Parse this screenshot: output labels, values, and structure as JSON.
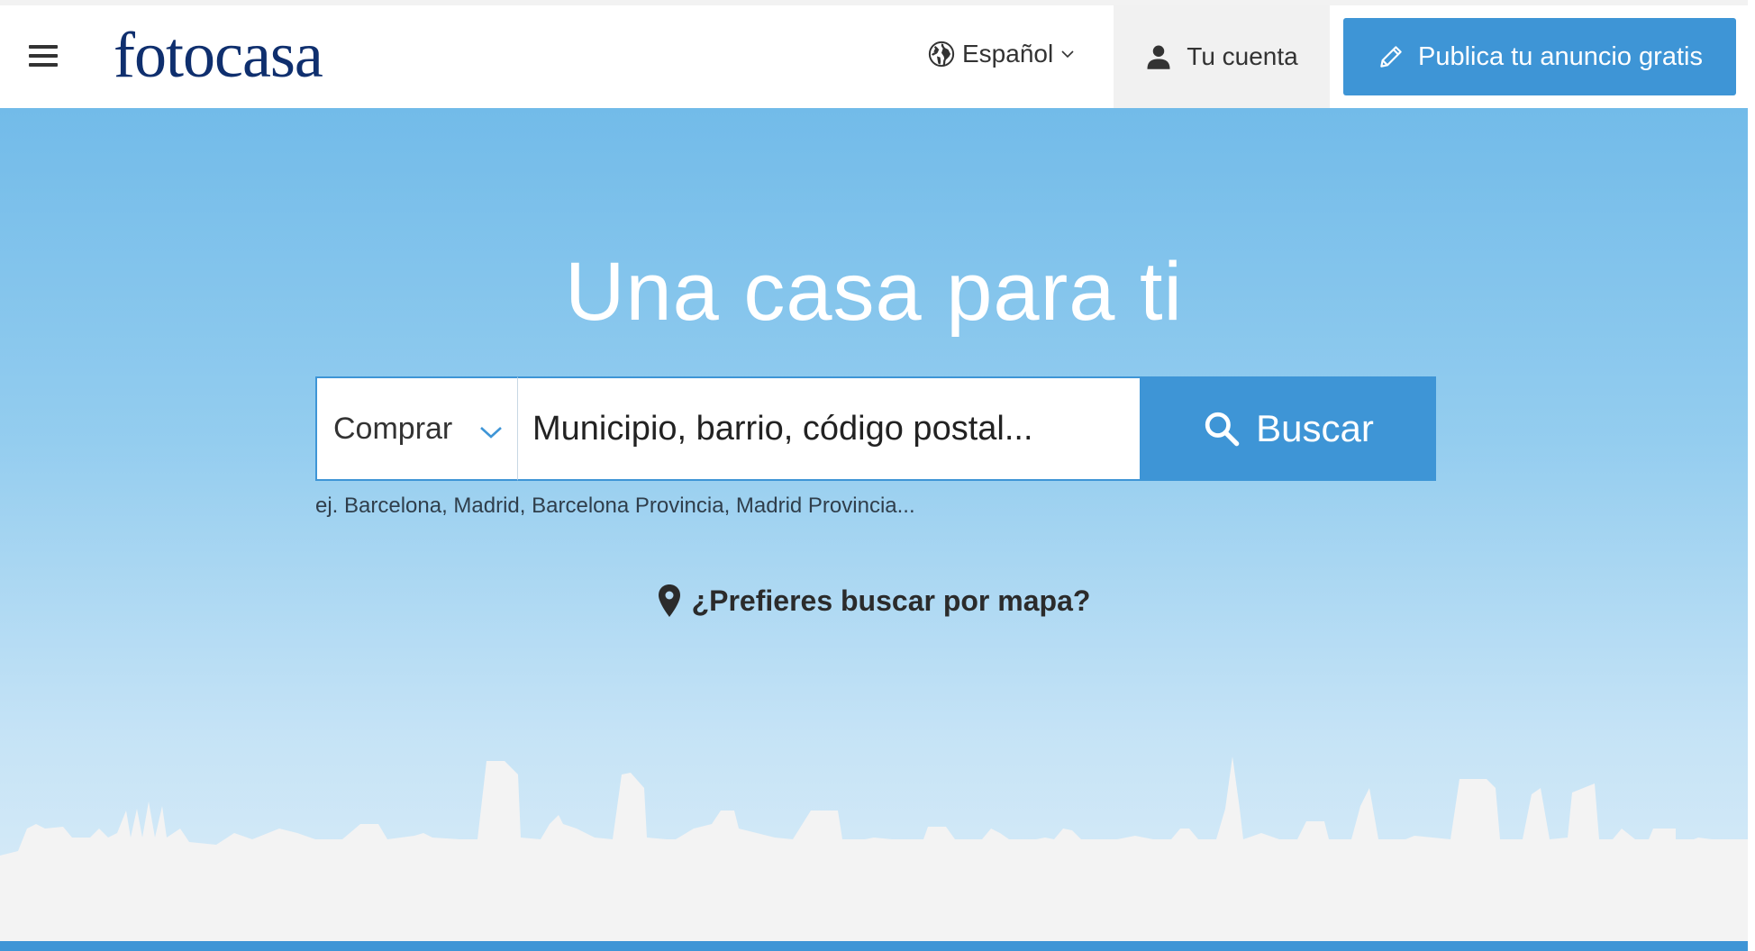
{
  "header": {
    "logo_text": "fotocasa",
    "language_label": "Español",
    "account_label": "Tu cuenta",
    "publish_label": "Publica tu anuncio gratis",
    "icons": {
      "menu": "hamburger-menu-icon",
      "language": "globe-icon",
      "language_dropdown": "chevron-down-icon",
      "account": "user-icon",
      "publish": "pencil-icon"
    }
  },
  "hero": {
    "title": "Una casa para ti",
    "operation_selected": "Comprar",
    "location_placeholder": "Municipio, barrio, código postal...",
    "search_label": "Buscar",
    "examples_text": "ej. Barcelona, Madrid, Barcelona Provincia, Madrid Provincia...",
    "map_link_label": "¿Prefieres buscar por mapa?",
    "icons": {
      "operation_dropdown": "chevron-down-icon",
      "search": "search-icon",
      "map": "map-pin-icon"
    }
  },
  "colors": {
    "brand_blue": "#3e95d6",
    "logo_navy": "#0f2f6e",
    "sky_top": "#72bbe9",
    "sky_bottom": "#dcedf8",
    "skyline": "#f3f3f3"
  }
}
